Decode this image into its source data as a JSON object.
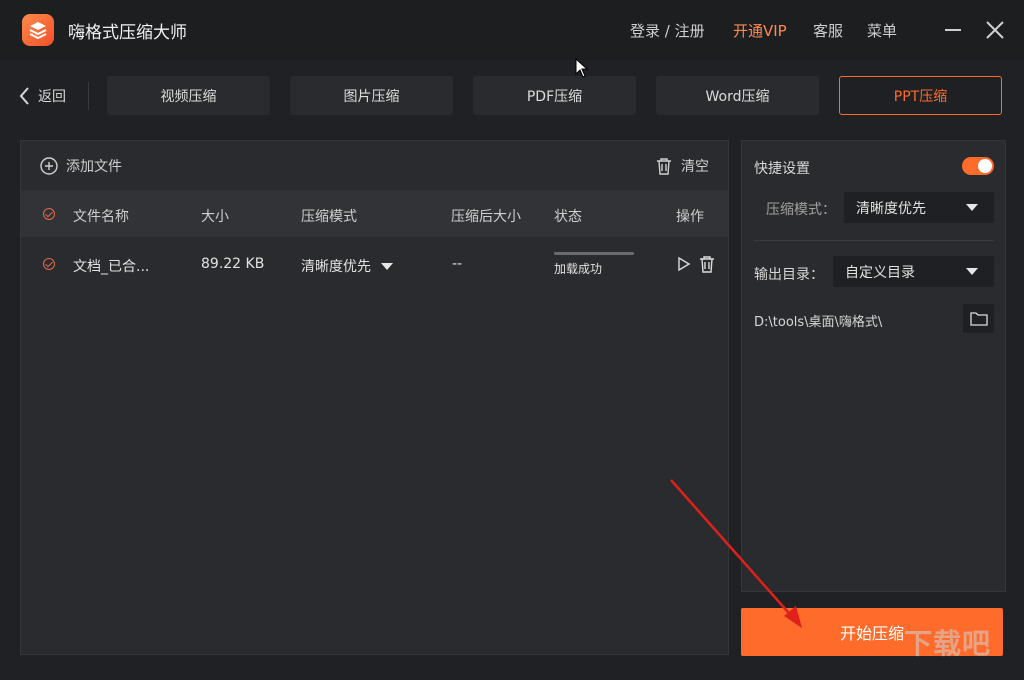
{
  "app": {
    "title": "嗨格式压缩大师"
  },
  "topbar": {
    "login": "登录 / 注册",
    "vip": "开通VIP",
    "service": "客服",
    "menu": "菜单"
  },
  "nav": {
    "back": "返回",
    "tabs": [
      "视频压缩",
      "图片压缩",
      "PDF压缩",
      "Word压缩",
      "PPT压缩"
    ],
    "active_tab": "PPT压缩"
  },
  "toolbar": {
    "add_file": "添加文件",
    "clear": "清空"
  },
  "table": {
    "columns": [
      "文件名称",
      "大小",
      "压缩模式",
      "压缩后大小",
      "状态",
      "操作"
    ],
    "rows": [
      {
        "name": "文档_已合...",
        "size": "89.22 KB",
        "mode": "清晰度优先",
        "compressed_size": "--",
        "status": "加载成功",
        "progress": 1.0
      }
    ]
  },
  "settings": {
    "quick_settings_label": "快捷设置",
    "quick_settings_on": true,
    "mode_label": "压缩模式：",
    "mode_value": "清晰度优先",
    "output_label": "输出目录：",
    "output_value": "自定义目录",
    "output_path": "D:\\tools\\桌面\\嗨格式\\"
  },
  "start_button": "开始压缩",
  "watermark": "下载吧",
  "colors": {
    "accent": "#ff6b2b",
    "background": "#202124",
    "panel": "#2a2b2e"
  }
}
